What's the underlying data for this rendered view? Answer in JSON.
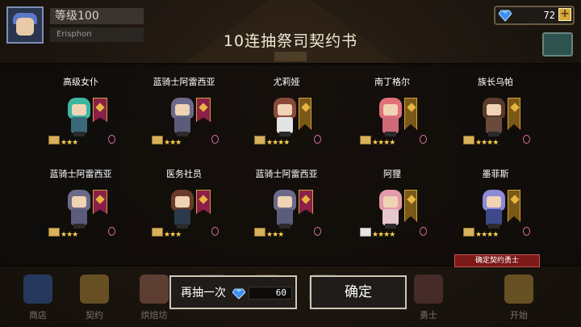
{
  "header": {
    "level_label": "等级100",
    "player_name": "Erisphon",
    "gem_count": "72",
    "plus_label": "+",
    "title": "10连抽祭司契约书"
  },
  "characters": [
    {
      "name": "高级女仆",
      "stars": "★★★",
      "rarity_scroll": "gold",
      "hair": "#3fb6a4",
      "body": "#3a6a7a"
    },
    {
      "name": "蓝骑士阿雷西亚",
      "stars": "★★★",
      "rarity_scroll": "gold",
      "hair": "#6b6a8a",
      "body": "#5b5c7c"
    },
    {
      "name": "尤莉娅",
      "stars": "★★★★",
      "rarity_scroll": "gold",
      "hair": "#8a4a3a",
      "body": "#e4e4e4"
    },
    {
      "name": "南丁格尔",
      "stars": "★★★★",
      "rarity_scroll": "gold",
      "hair": "#e0707a",
      "body": "#d06a78"
    },
    {
      "name": "族长乌帕",
      "stars": "★★★★",
      "rarity_scroll": "gold",
      "hair": "#5a3a2a",
      "body": "#6a4a3a"
    },
    {
      "name": "蓝骑士阿雷西亚",
      "stars": "★★★",
      "rarity_scroll": "gold",
      "hair": "#6b6a8a",
      "body": "#5b5c7c"
    },
    {
      "name": "医务社员",
      "stars": "★★★",
      "rarity_scroll": "gold",
      "hair": "#6a3a2a",
      "body": "#2a3a4a"
    },
    {
      "name": "蓝骑士阿雷西亚",
      "stars": "★★★",
      "rarity_scroll": "gold",
      "hair": "#6b6a8a",
      "body": "#5b5c7c"
    },
    {
      "name": "阿狸",
      "stars": "★★★★",
      "rarity_scroll": "white",
      "hair": "#e49aa8",
      "body": "#e8c8d0"
    },
    {
      "name": "墨菲斯",
      "stars": "★★★★",
      "rarity_scroll": "gold",
      "hair": "#8c8ad8",
      "body": "#3c4a8a"
    }
  ],
  "confirm_tag": "确定契约勇士",
  "buttons": {
    "again_label": "再抽一次",
    "again_cost": "60",
    "ok_label": "确定"
  },
  "nav": [
    {
      "label": "商店",
      "color": "#3a6ac0"
    },
    {
      "label": "契约",
      "color": "#c89a40"
    },
    {
      "label": "烘焙坊",
      "color": "#b07060"
    },
    {
      "label": "",
      "color": "#5a5a7a"
    },
    {
      "label": "",
      "color": "#6a5a4a"
    },
    {
      "label": "",
      "color": "#4a6a5a"
    },
    {
      "label": "勇士",
      "color": "#7a4a4a"
    },
    {
      "label": "开始",
      "color": "#c8a040"
    }
  ],
  "colors": {
    "accent_gold": "#ffd24a",
    "banner_red": "#8b1f47",
    "tag_red": "#7c1a1a"
  }
}
